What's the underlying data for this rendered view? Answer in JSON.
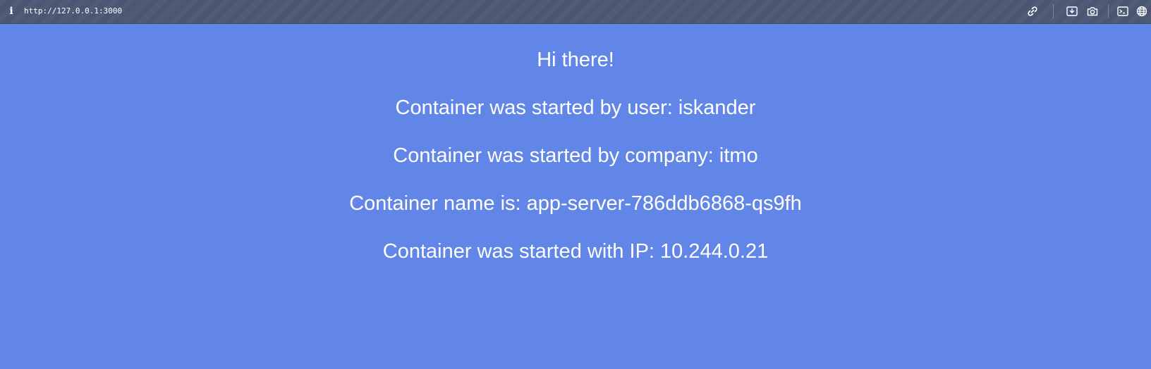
{
  "browser": {
    "url": "http://127.0.0.1:3000",
    "info_icon_glyph": "i",
    "toolbar_icons": [
      "link-icon",
      "save-page-icon",
      "screenshot-icon",
      "console-icon",
      "globe-icon"
    ],
    "colors": {
      "toolbar_bg": "#4a5672",
      "text": "#ffffff"
    }
  },
  "page": {
    "background": "#6286e8",
    "greeting": "Hi there!",
    "user_line": "Container was started by user: iskander",
    "company_line": "Container was started by company: itmo",
    "name_line": "Container name is: app-server-786ddb6868-qs9fh",
    "ip_line": "Container was started with IP: 10.244.0.21"
  }
}
